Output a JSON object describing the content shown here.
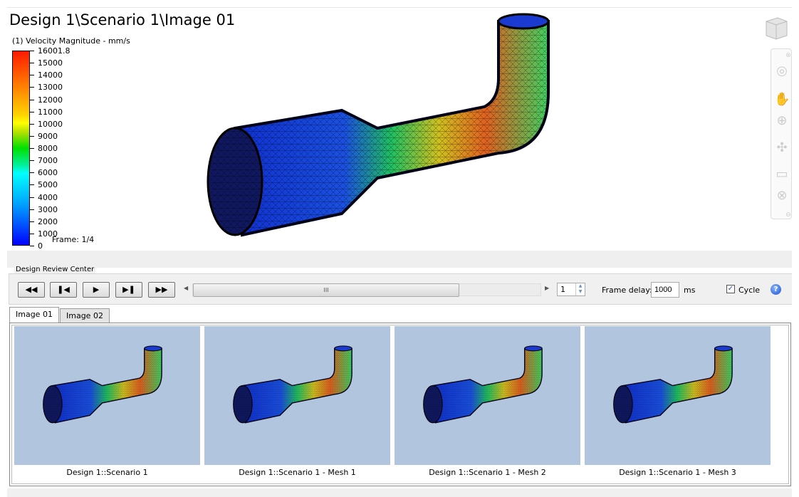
{
  "title": "Design 1\\Scenario 1\\Image 01",
  "legend": {
    "title": "(1) Velocity Magnitude - mm/s",
    "max": "16001.8",
    "ticks": [
      "15000",
      "14000",
      "13000",
      "12000",
      "11000",
      "10000",
      "9000",
      "8000",
      "7000",
      "6000",
      "5000",
      "4000",
      "3000",
      "2000",
      "1000",
      "0"
    ],
    "frame": "Frame: 1/4"
  },
  "nav_icons": [
    "view-cube-icon",
    "close-icon",
    "steering-wheel-icon",
    "pan-icon",
    "zoom-icon",
    "orbit-icon",
    "center-icon",
    "rewind-icon",
    "collapse-icon"
  ],
  "review": {
    "label": "Design Review Center",
    "buttons": [
      {
        "name": "first-frame",
        "icon": "⏮",
        "glyph": "◀◀"
      },
      {
        "name": "prev-frame",
        "glyph": "❚◀"
      },
      {
        "name": "play",
        "glyph": "▶"
      },
      {
        "name": "next-frame",
        "glyph": "▶❚"
      },
      {
        "name": "last-frame",
        "glyph": "▶▶"
      }
    ],
    "slider_grip": "III",
    "frame_value": "1",
    "frame_delay_label": "Frame delay:",
    "frame_delay_value": "1000",
    "unit": "ms",
    "cycle_label": "Cycle",
    "cycle_checked": true
  },
  "tabs": [
    {
      "label": "Image 01",
      "active": true
    },
    {
      "label": "Image 02",
      "active": false
    }
  ],
  "thumbnails": [
    {
      "caption": "Design 1::Scenario 1"
    },
    {
      "caption": "Design 1::Scenario 1 - Mesh 1"
    },
    {
      "caption": "Design 1::Scenario 1 - Mesh 2"
    },
    {
      "caption": "Design 1::Scenario 1 - Mesh 3"
    }
  ],
  "colors": {
    "thumb_bg": "#b2c5df",
    "accent": "#1a4fd0"
  }
}
